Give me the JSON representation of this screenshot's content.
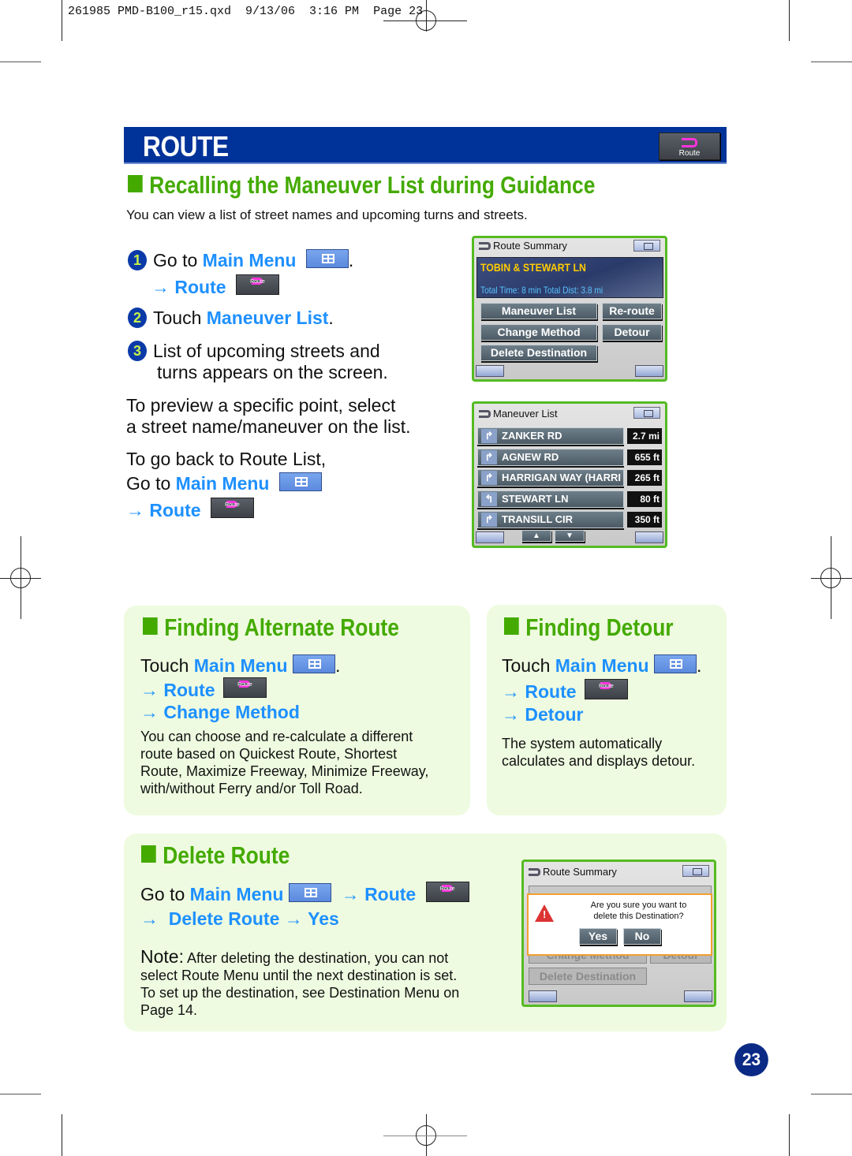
{
  "slug": "261985 PMD-B100_r15.qxd  9/13/06  3:16 PM  Page 23",
  "header": {
    "title": "ROUTE",
    "route_button_label": "Route"
  },
  "icons": {
    "main_menu": "main-menu-grid-icon",
    "route": "route-s-arrow-icon",
    "arrow": "→"
  },
  "colors": {
    "header_blue": "#003399",
    "section_green": "#44aa00",
    "link_blue": "#1e90ff",
    "panel_bg": "#eefbe0",
    "screen_border": "#55bb22"
  },
  "recall": {
    "title": "Recalling the Maneuver List during Guidance",
    "intro": "You can view a list of street names and upcoming turns and streets.",
    "steps": [
      {
        "num": "1",
        "prefix": "Go to ",
        "link": "Main Menu",
        "suffix": ".",
        "sub_arrow": "→",
        "sub_link": "Route",
        "route_btn": "Route"
      },
      {
        "num": "2",
        "prefix": "Touch ",
        "link": "Maneuver List",
        "suffix": "."
      },
      {
        "num": "3",
        "line1": "List of upcoming streets and",
        "line2": "turns appears on the screen."
      }
    ],
    "preview_line1": "To preview a specific point, select",
    "preview_line2": "a street name/maneuver on the list.",
    "back_line1": "To go back to Route List,",
    "back_prefix": "Go to ",
    "back_link": "Main Menu",
    "back_arrow": "→",
    "back_sub_link": "Route",
    "back_route_btn": "Route"
  },
  "route_summary_screen": {
    "title": "Route Summary",
    "destination": "TOBIN & STEWART LN",
    "totals": "Total Time: 8 min   Total Dist: 3.8 mi",
    "buttons": [
      "Maneuver List",
      "Re-route",
      "Change Method",
      "Detour",
      "Delete Destination"
    ]
  },
  "maneuver_screen": {
    "title": "Maneuver List",
    "rows": [
      {
        "turn": "right",
        "street": "ZANKER RD",
        "dist": "2.7 mi"
      },
      {
        "turn": "right",
        "street": "AGNEW RD",
        "dist": "655 ft"
      },
      {
        "turn": "right",
        "street": "HARRIGAN WAY (HARRI",
        "dist": "265 ft"
      },
      {
        "turn": "left",
        "street": "STEWART LN",
        "dist": "80 ft"
      },
      {
        "turn": "right",
        "street": "TRANSILL CIR",
        "dist": "350 ft"
      }
    ]
  },
  "alternate": {
    "title": "Finding Alternate Route",
    "touch": "Touch ",
    "link_main": "Main Menu",
    "dot": ".",
    "arrow": "→",
    "link_route": "Route",
    "route_btn": "Route",
    "link_change": "Change Method",
    "desc": [
      "You can choose and re-calculate a different",
      "route based on Quickest Route, Shortest",
      "Route, Maximize Freeway, Minimize Freeway,",
      "with/without Ferry and/or Toll Road."
    ]
  },
  "detour": {
    "title": "Finding Detour",
    "touch": "Touch ",
    "link_main": "Main Menu",
    "dot": ".",
    "arrow": "→",
    "link_route": "Route",
    "route_btn": "Route",
    "link_detour": "Detour",
    "desc": [
      "The system automatically",
      "calculates and displays detour."
    ]
  },
  "delete": {
    "title": "Delete Route",
    "goto": "Go to ",
    "link_main": "Main Menu",
    "arrow": "→",
    "link_route": "Route",
    "route_btn": "Route",
    "link_delete": "Delete Route",
    "link_yes": "Yes",
    "note_label": "Note:",
    "note": [
      "After deleting the destination, you can not",
      "select Route Menu until the next destination is set.",
      "To set up the destination, see Destination Menu on",
      "Page 14."
    ]
  },
  "delete_screen": {
    "title": "Route Summary",
    "dialog_line1": "Are you sure you want to",
    "dialog_line2": "delete this Destination?",
    "yes": "Yes",
    "no": "No",
    "greyed_buttons": [
      "Change Method",
      "Detour",
      "Delete Destination"
    ]
  },
  "page_number": "23"
}
